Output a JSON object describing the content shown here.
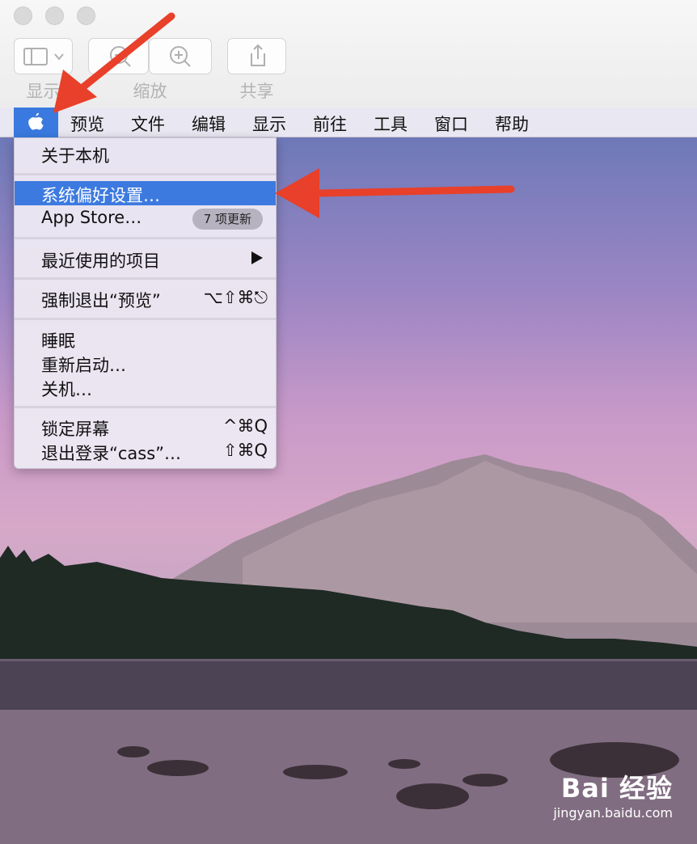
{
  "toolbar": {
    "display_label": "显示",
    "zoom_label": "缩放",
    "share_label": "共享"
  },
  "menubar": {
    "items": [
      "预览",
      "文件",
      "编辑",
      "显示",
      "前往",
      "工具",
      "窗口",
      "帮助"
    ]
  },
  "apple_menu": {
    "about": "关于本机",
    "prefs": "系统偏好设置…",
    "appstore": "App Store…",
    "appstore_badge": "7 项更新",
    "recent": "最近使用的项目",
    "force_quit": "强制退出“预览”",
    "force_quit_shortcut": "⌥⇧⌘⎋",
    "sleep": "睡眠",
    "restart": "重新启动…",
    "shutdown": "关机…",
    "lock": "锁定屏幕",
    "lock_shortcut": "^⌘Q",
    "logout": "退出登录“cass”…",
    "logout_shortcut": "⇧⌘Q"
  },
  "watermark": {
    "brand": "Bai 经验",
    "url": "jingyan.baidu.com"
  },
  "colors": {
    "highlight": "#3d7ae0",
    "arrow": "#e8402a"
  }
}
